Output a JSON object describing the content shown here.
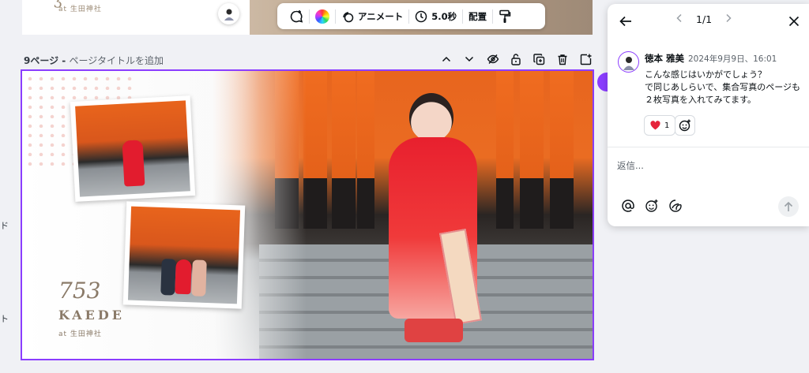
{
  "prev_page": {
    "tagline": "at 生田神社"
  },
  "toolbar": {
    "animate_label": "アニメート",
    "duration_label": "5.0秒",
    "position_label": "配置"
  },
  "page_header": {
    "page_number": "9ページ",
    "separator": " - ",
    "title_placeholder": "ページタイトルを追加"
  },
  "design": {
    "logo_text": "753",
    "name": "KAEDE",
    "location": "at 生田神社"
  },
  "left_fragments": [
    "ド",
    "ト"
  ],
  "comment_panel": {
    "pagination": "1/1",
    "author": "徳本 雅美",
    "timestamp": "2024年9月9日、16:01",
    "text": "こんな感じはいかがでしょう？\nで同じあしらいで、集合写真のページも２枚写真を入れてみてます。",
    "reaction_count": "1",
    "reply_placeholder": "返信..."
  },
  "colors": {
    "accent": "#8b3dff",
    "heart": "#e5243b"
  }
}
